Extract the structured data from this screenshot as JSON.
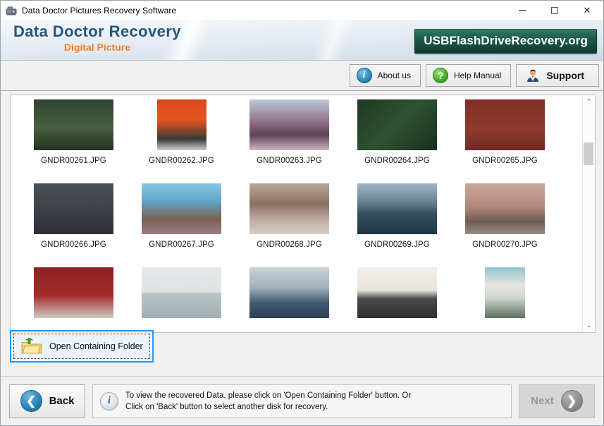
{
  "window": {
    "title": "Data Doctor Pictures Recovery Software",
    "icon": "camera-scanner-icon",
    "minimize": "–",
    "maximize": "□",
    "close": "✕"
  },
  "header": {
    "logo_main": "Data Doctor Recovery",
    "logo_sub": "Digital Picture",
    "site_badge": "USBFlashDriveRecovery.org",
    "logo_main_color": "#21567f",
    "logo_sub_color": "#f07f2a",
    "badge_color": "#1d5c4a"
  },
  "toolbar": {
    "about_label": "About us",
    "about_icon": "info-icon",
    "about_glyph": "i",
    "help_label": "Help Manual",
    "help_icon": "question-icon",
    "help_glyph": "?",
    "support_label": "Support",
    "support_icon": "support-agent-icon"
  },
  "thumbnails": {
    "rows": [
      [
        {
          "name": "GNDR00261.JPG",
          "w": 113,
          "kind": "suspension-bridge-forest"
        },
        {
          "name": "GNDR00262.JPG",
          "w": 70,
          "kind": "torii-gate-path"
        },
        {
          "name": "GNDR00263.JPG",
          "w": 113,
          "kind": "crowd-festival"
        },
        {
          "name": "GNDR00264.JPG",
          "w": 113,
          "kind": "child-christmas-tree"
        },
        {
          "name": "GNDR00265.JPG",
          "w": 113,
          "kind": "float-on-balloons-brick"
        }
      ],
      [
        {
          "name": "GNDR00266.JPG",
          "w": 113,
          "kind": "four-friends-portrait"
        },
        {
          "name": "GNDR00267.JPG",
          "w": 113,
          "kind": "woman-peace-sign-festival"
        },
        {
          "name": "GNDR00268.JPG",
          "w": 113,
          "kind": "friends-walking-street"
        },
        {
          "name": "GNDR00269.JPG",
          "w": 113,
          "kind": "mountain-lake-reflection"
        },
        {
          "name": "GNDR00270.JPG",
          "w": 113,
          "kind": "two-women-cherry-blossom"
        }
      ],
      [
        {
          "name": "",
          "w": 113,
          "kind": "two-boys-red-wall"
        },
        {
          "name": "",
          "w": 113,
          "kind": "woman-sunglasses-sea"
        },
        {
          "name": "",
          "w": 113,
          "kind": "woman-denim-crowd"
        },
        {
          "name": "",
          "w": 113,
          "kind": "friends-group-laughing"
        },
        {
          "name": "",
          "w": 57,
          "kind": "group-on-steps-building"
        }
      ]
    ]
  },
  "scrollbar": {
    "up_arrow": "⌃",
    "down_arrow": "⌄"
  },
  "open_folder": {
    "label": "Open Containing Folder",
    "icon": "folder-upload-icon",
    "focus_color": "#2196f3"
  },
  "footer": {
    "back_label": "Back",
    "back_icon": "chevron-left-circle-icon",
    "back_glyph": "❮",
    "next_label": "Next",
    "next_icon": "chevron-right-circle-icon",
    "next_glyph": "❯",
    "next_disabled": true,
    "status_icon": "info-icon",
    "status_glyph": "i",
    "status_line1": "To view the recovered Data, please click on 'Open Containing Folder' button. Or",
    "status_line2": "Click on 'Back' button to select another disk for recovery."
  }
}
